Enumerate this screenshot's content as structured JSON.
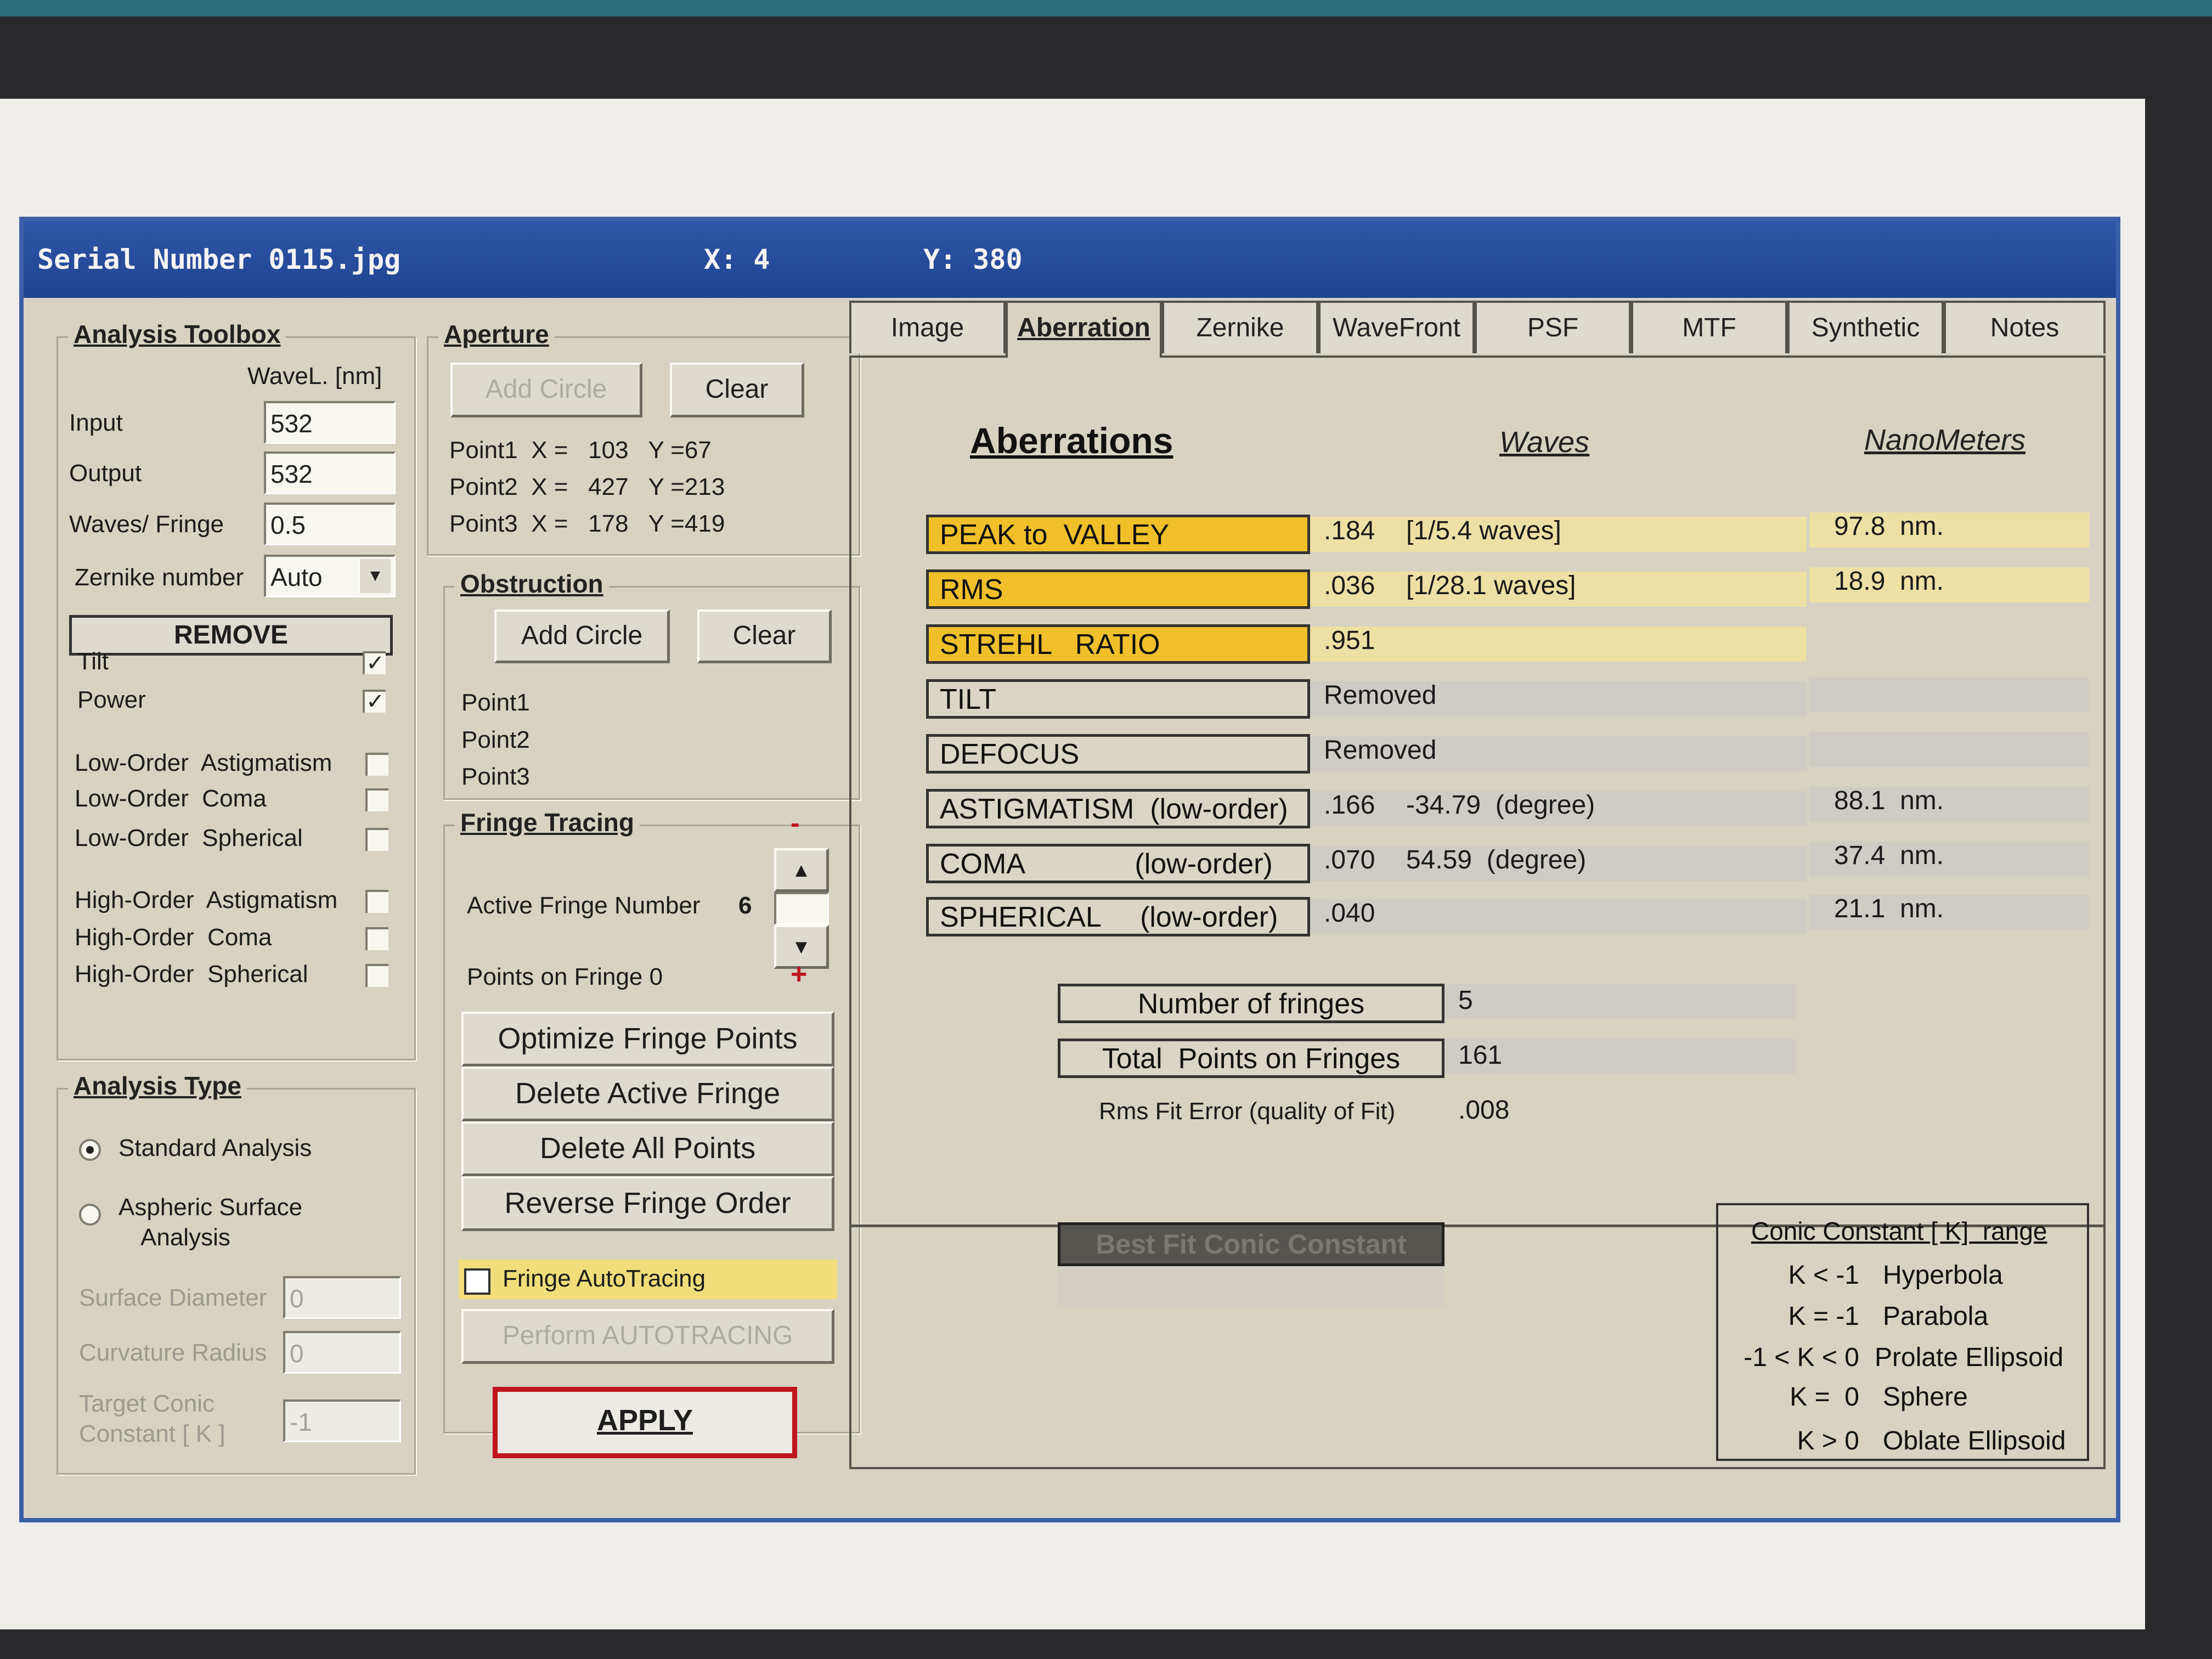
{
  "window": {
    "title": "Serial Number 0115.jpg",
    "x_readout": "X: 4",
    "y_readout": "Y: 380"
  },
  "toolbox": {
    "title": "Analysis Toolbox",
    "wavel_header": "WaveL. [nm]",
    "input_label": "Input",
    "input_value": "532",
    "output_label": "Output",
    "output_value": "532",
    "waves_label": "Waves/ Fringe",
    "waves_value": "0.5",
    "zernike_label": "Zernike number",
    "zernike_value": "Auto",
    "remove_label": "REMOVE",
    "terms": [
      {
        "label": "Tilt",
        "checked": true
      },
      {
        "label": "Power",
        "checked": true
      },
      {
        "label": "Low-Order  Astigmatism",
        "checked": false
      },
      {
        "label": "Low-Order  Coma",
        "checked": false
      },
      {
        "label": "Low-Order  Spherical",
        "checked": false
      },
      {
        "label": "High-Order  Astigmatism",
        "checked": false
      },
      {
        "label": "High-Order  Coma",
        "checked": false
      },
      {
        "label": "High-Order  Spherical",
        "checked": false
      }
    ],
    "check_mark": "✓"
  },
  "analysis_type": {
    "title": "Analysis Type",
    "standard": "Standard  Analysis",
    "aspheric_1": "Aspheric  Surface",
    "aspheric_2": "Analysis",
    "surface_diameter_label": "Surface  Diameter",
    "surface_diameter_value": "0",
    "curvature_radius_label": "Curvature  Radius",
    "curvature_radius_value": "0",
    "target_conic_label_1": "Target Conic",
    "target_conic_label_2": "Constant [ K ]",
    "target_conic_value": "-1"
  },
  "aperture": {
    "title": "Aperture",
    "add_circle": "Add Circle",
    "clear": "Clear",
    "points": [
      "Point1  X =   103   Y =67",
      "Point2  X =   427   Y =213",
      "Point3  X =   178   Y =419"
    ]
  },
  "obstruction": {
    "title": "Obstruction",
    "add_circle": "Add Circle",
    "clear": "Clear",
    "points": [
      "Point1",
      "Point2",
      "Point3"
    ]
  },
  "fringe_tracing": {
    "title": "Fringe Tracing",
    "minus": "-",
    "plus": "+",
    "active_label": "Active Fringe Number",
    "active_value": "6",
    "points_label": "Points  on  Fringe 0",
    "optimize": "Optimize Fringe Points",
    "delete_active": "Delete Active Fringe",
    "delete_all": "Delete  All  Points",
    "reverse": "Reverse  Fringe Order",
    "autotracing": "Fringe AutoTracing",
    "perform": "Perform  AUTOTRACING",
    "up_arrow": "▲",
    "down_arrow": "▼"
  },
  "apply_label": "APPLY",
  "tabs": [
    "Image",
    "Aberration",
    "Zernike",
    "WaveFront",
    "PSF",
    "MTF",
    "Synthetic",
    "Notes"
  ],
  "aberrations": {
    "title": "Aberrations",
    "waves_header": "Waves",
    "nm_header": "NanoMeters",
    "rows": [
      {
        "label": "PEAK to  VALLEY",
        "wave": ".184",
        "detail": "[1/5.4 waves]",
        "nm": "97.8  nm."
      },
      {
        "label": "RMS",
        "wave": ".036",
        "detail": "[1/28.1 waves]",
        "nm": "18.9  nm."
      },
      {
        "label": "STREHL   RATIO",
        "wave": ".951",
        "detail": "",
        "nm": ""
      },
      {
        "label": "TILT",
        "wave": "Removed",
        "detail": "",
        "nm": ""
      },
      {
        "label": "DEFOCUS",
        "wave": "Removed",
        "detail": "",
        "nm": ""
      },
      {
        "label": "ASTIGMATISM  (low-order)",
        "wave": ".166",
        "detail": "-34.79  (degree)",
        "nm": "88.1  nm."
      },
      {
        "label": "COMA              (low-order)",
        "wave": ".070",
        "detail": "54.59  (degree)",
        "nm": "37.4  nm."
      },
      {
        "label": "SPHERICAL     (low-order)",
        "wave": ".040",
        "detail": "",
        "nm": "21.1  nm."
      }
    ],
    "num_fringes_label": "Number of fringes",
    "num_fringes_value": "5",
    "total_points_label": "Total  Points on Fringes",
    "total_points_value": "161",
    "rms_fit_label": "Rms Fit Error (quality of Fit)",
    "rms_fit_value": ".008",
    "best_fit_label": "Best Fit Conic Constant"
  },
  "conic": {
    "title": "Conic Constant [ K]  range",
    "rows": [
      {
        "cond": "K < -1",
        "name": "Hyperbola"
      },
      {
        "cond": "K = -1",
        "name": "Parabola"
      },
      {
        "cond": "-1 < K < 0",
        "name": "Prolate Ellipsoid"
      },
      {
        "cond": "K =  0",
        "name": "Sphere"
      },
      {
        "cond": "K > 0",
        "name": "Oblate Ellipsoid"
      }
    ]
  },
  "colors": {
    "title_bar": "#2f56a8",
    "highlight_yellow": "#f0bf2a",
    "apply_border": "#c0141e"
  }
}
